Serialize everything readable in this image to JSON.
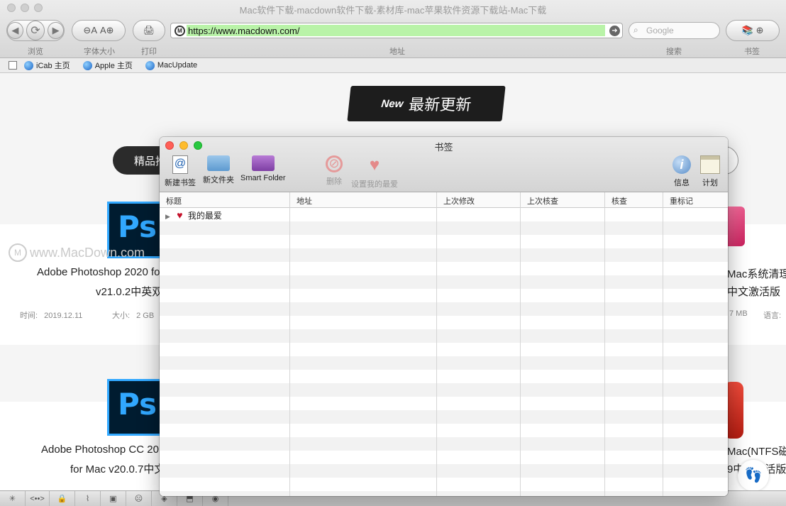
{
  "window": {
    "title": "Mac软件下载-macdown软件下载-素材库-mac苹果软件资源下载站-Mac下载"
  },
  "toolbar": {
    "browse_label": "浏览",
    "font_size_label": "字体大小",
    "font_smaller": "A",
    "font_bigger": "A",
    "print_label": "打印",
    "address_label": "地址",
    "url": "https://www.macdown.com/",
    "search_label": "搜索",
    "search_placeholder": "Google",
    "bookmarks_label": "书签"
  },
  "bookmarks_bar": {
    "items": [
      {
        "label": "iCab 主页"
      },
      {
        "label": "Apple 主页"
      },
      {
        "label": "MacUpdate"
      }
    ]
  },
  "page": {
    "banner_new": "New",
    "banner_text": "最新更新",
    "featured_button": "精品推",
    "watermark": "www.MacDown.com",
    "cards_row1": [
      {
        "title_line1": "Adobe Photoshop 2020 fo",
        "title_line2": "v21.0.2中英双",
        "date_label": "时间:",
        "date": "2019.12.11",
        "size_label": "大小:",
        "size": "2 GB"
      },
      {
        "title_line1": "Mac系统清理",
        "title_line2": "中文激活版",
        "size": "7 MB",
        "lang_label": "语言:"
      }
    ],
    "cards_row2": [
      {
        "title_line1": "Adobe Photoshop CC 201",
        "title_line2": "for Mac v20.0.7中文"
      },
      {
        "title_line1": "Mac(NTFS磁",
        "title_line2": "9中文激活版"
      }
    ],
    "ps_icon_text": "Ps"
  },
  "dialog": {
    "title": "书签",
    "tools": {
      "new_bookmark": "新建书签",
      "new_folder": "新文件夹",
      "smart_folder": "Smart Folder",
      "delete": "删除",
      "set_favorite": "设置我的最爱",
      "info": "信息",
      "schedule": "计划"
    },
    "columns": [
      "标题",
      "地址",
      "上次修改",
      "上次核查",
      "核查",
      "重标记"
    ],
    "rows": [
      {
        "title": "我的最爱"
      }
    ]
  },
  "statusbar": {
    "code_label": "<••>"
  },
  "colors": {
    "url_progress": "#b9f3a8",
    "close": "#ff5f57",
    "minimize": "#febc2e",
    "zoom": "#28c840",
    "ps_blue": "#31a8ff"
  }
}
